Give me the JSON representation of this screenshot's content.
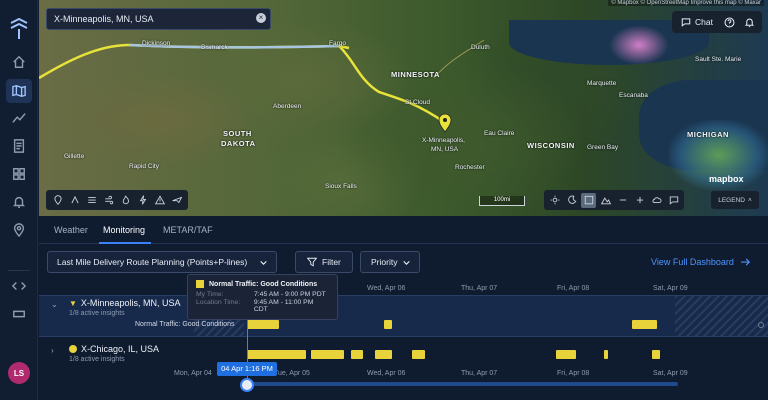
{
  "search": {
    "value": "X-Minneapolis, MN, USA"
  },
  "attribution": "© Mapbox © OpenStreetMap Improve this map © Maxar",
  "header": {
    "chat_label": "Chat"
  },
  "map": {
    "labels": {
      "dickinson": "Dickinson",
      "bismarck": "Bismarck",
      "fargo": "Fargo",
      "duluth": "Duluth",
      "minnesota": "MINNESOTA",
      "aberdeen": "Aberdeen",
      "st_cloud": "St Cloud",
      "south_dakota_1": "SOUTH",
      "south_dakota_2": "DAKOTA",
      "eau_claire": "Eau Claire",
      "wisconsin": "WISCONSIN",
      "green_bay": "Green Bay",
      "gillette": "Gillette",
      "rapid_city": "Rapid City",
      "rochester": "Rochester",
      "sioux_falls": "Sioux Falls",
      "michigan": "MICHIGAN",
      "escanaba": "Escanaba",
      "sault": "Sault Ste. Marie",
      "marquette": "Marquette",
      "marker_1": "X-Minneapolis,",
      "marker_2": "MN, USA"
    },
    "scale": "100mi",
    "logo": "mapbox",
    "legend_label": "LEGEND"
  },
  "tabs": [
    {
      "label": "Weather"
    },
    {
      "label": "Monitoring"
    },
    {
      "label": "METAR/TAF"
    }
  ],
  "controls": {
    "plan_select": "Last Mile Delivery Route Planning (Points+P-lines)",
    "filter_label": "Filter",
    "priority_label": "Priority",
    "view_full": "View Full Dashboard"
  },
  "timeline": {
    "days_top": [
      "Wed, Apr 06",
      "Thu, Apr 07",
      "Fri, Apr 08",
      "Sat, Apr 09"
    ],
    "days_bottom": [
      "Mon, Apr 04",
      "Tue, Apr 05",
      "Wed, Apr 06",
      "Thu, Apr 07",
      "Fri, Apr 08",
      "Sat, Apr 09"
    ],
    "locations": [
      {
        "name": "X-Minneapolis, MN, USA",
        "sub": "1/8 active insights",
        "row_label": "Normal Traffic: Good Conditions"
      },
      {
        "name": "X-Chicago, IL, USA",
        "sub": "1/8 active insights"
      }
    ],
    "slider_label": "04 Apr 1:16 PM"
  },
  "tooltip": {
    "title": "Normal Traffic: Good Conditions",
    "my_time_key": "My Time:",
    "my_time_val": "7:45 AM - 9:00 PM PDT",
    "loc_time_key": "Location Time:",
    "loc_time_val": "9:45 AM - 11:00 PM CDT"
  },
  "colors": {
    "accent": "#3b82f6",
    "insight": "#e8d43a",
    "avatar": "#b02a6e"
  },
  "user": {
    "initials": "LS"
  }
}
